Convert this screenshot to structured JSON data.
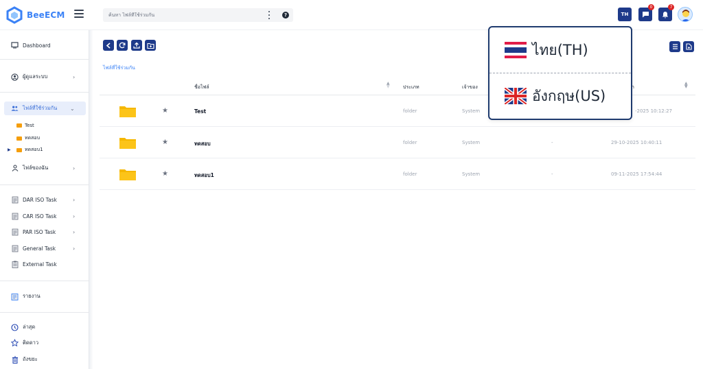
{
  "app": {
    "name": "BeeECM"
  },
  "search": {
    "placeholder": "ค้นหา ไฟล์ที่ใช้ร่วมกัน"
  },
  "header": {
    "lang_code": "TH",
    "message_count": "0",
    "notification_count": "7"
  },
  "sidebar": {
    "dashboard": "Dashboard",
    "admin": "ผู้ดูแลระบบ",
    "shared_files": "ไฟล์ที่ใช้ร่วมกัน",
    "shared_children": [
      "Test",
      "ทดสอบ",
      "ทดสอบ1"
    ],
    "my_files": "ไฟล์ของฉัน",
    "tasks": [
      "DAR ISO Task",
      "CAR ISO Task",
      "PAR ISO Task",
      "General Task",
      "External Task"
    ],
    "report": "รายงาน",
    "recent": "ล่าสุด",
    "starred": "ติดดาว",
    "trash": "ถังขยะ"
  },
  "breadcrumb": "ไฟล์ที่ใช้ร่วมกัน",
  "table": {
    "headers": {
      "name": "ชื่อไฟล์",
      "type": "ประเภท",
      "owner": "เจ้าของ",
      "date_partial": "า"
    },
    "rows": [
      {
        "name": "Test",
        "type": "folder",
        "owner": "System",
        "size": "",
        "date": "-2025 10:12:27"
      },
      {
        "name": "ทดสอบ",
        "type": "folder",
        "owner": "System",
        "size": "-",
        "date": "29-10-2025 10:40:11"
      },
      {
        "name": "ทดสอบ1",
        "type": "folder",
        "owner": "System",
        "size": "-",
        "date": "09-11-2025 17:54:44"
      }
    ]
  },
  "language_menu": {
    "options": [
      {
        "label": "ไทย(TH)",
        "flag": "thailand-flag"
      },
      {
        "label": "อังกฤษ(US)",
        "flag": "uk-flag"
      }
    ]
  },
  "colors": {
    "primary": "#1e3a8a",
    "accent": "#3b82f6",
    "folder": "#fbbf24",
    "badge": "#dc2626"
  }
}
